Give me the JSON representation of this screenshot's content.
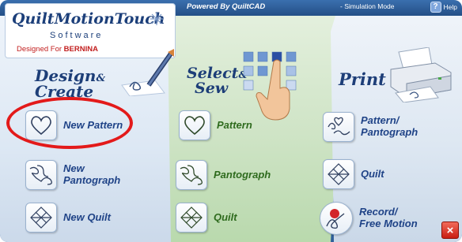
{
  "topbar": {
    "powered_by": "Powered By QuiltCAD",
    "mode": "- Simulation Mode",
    "help_label": "Help"
  },
  "logo": {
    "title": "QuiltMotionTouch",
    "subtitle": "Software",
    "tagline_prefix": "Designed For ",
    "tagline_brand": "BERNINA"
  },
  "sections": {
    "design": {
      "title_main": "Design",
      "title_amp": "&",
      "title_second": "Create"
    },
    "select": {
      "title_main": "Select",
      "title_amp": "&",
      "title_second": "Sew"
    },
    "print": {
      "title_main": "Print"
    }
  },
  "design_tiles": [
    {
      "label_line1": "New Pattern",
      "label_line2": ""
    },
    {
      "label_line1": "New",
      "label_line2": "Pantograph"
    },
    {
      "label_line1": "New Quilt",
      "label_line2": ""
    }
  ],
  "select_tiles": [
    {
      "label_line1": "Pattern",
      "label_line2": ""
    },
    {
      "label_line1": "Pantograph",
      "label_line2": ""
    },
    {
      "label_line1": "Quilt",
      "label_line2": ""
    }
  ],
  "print_tiles": [
    {
      "label_line1": "Pattern/",
      "label_line2": "Pantograph"
    },
    {
      "label_line1": "Quilt",
      "label_line2": ""
    },
    {
      "label_line1": "Record/",
      "label_line2": "Free Motion"
    }
  ],
  "close_label": "×",
  "colors": {
    "highlight": "#e31a1a",
    "design_text": "#1f4387",
    "select_text": "#2f6b1e"
  }
}
